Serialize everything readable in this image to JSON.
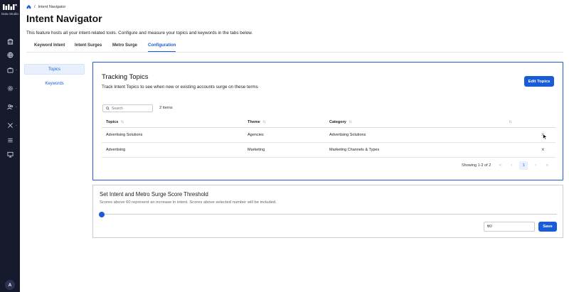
{
  "app": {
    "brand": "Data Studio",
    "user_initial": "A"
  },
  "rail": {
    "items": [
      {
        "icon": "building-icon"
      },
      {
        "icon": "globe-icon"
      },
      {
        "icon": "briefcase-icon"
      },
      {
        "icon": "gear-icon"
      },
      {
        "icon": "users-icon"
      },
      {
        "icon": "tools-icon"
      },
      {
        "icon": "list-icon"
      },
      {
        "icon": "monitor-icon"
      }
    ]
  },
  "breadcrumb": {
    "separator": "/",
    "current": "Intent Navigator"
  },
  "page": {
    "title": "Intent Navigator",
    "description": "This feature hosts all your intent-related tools. Configure and measure your topics and keywords in the tabs below."
  },
  "tabs": [
    {
      "label": "Keyword Intent",
      "active": false
    },
    {
      "label": "Intent Surges",
      "active": false
    },
    {
      "label": "Metro Surge",
      "active": false
    },
    {
      "label": "Configuration",
      "active": true
    }
  ],
  "subnav": [
    {
      "label": "Topics",
      "active": true
    },
    {
      "label": "Keywords",
      "active": false
    }
  ],
  "tracking": {
    "title": "Tracking Topics",
    "subtitle": "Track Intent Topics to see when new or existing accounts surge on these terms",
    "edit_label": "Edit Topics",
    "search_placeholder": "Search",
    "item_count": "2 items",
    "columns": [
      "Topics",
      "Theme",
      "Category"
    ],
    "rows": [
      {
        "topic": "Advertising Solutions",
        "theme": "Agencies",
        "category": "Advertising Solutions"
      },
      {
        "topic": "Advertising",
        "theme": "Marketing",
        "category": "Marketing Channels & Types"
      }
    ],
    "pagination": {
      "info": "Showing 1-2 of 2",
      "current_page": "1"
    }
  },
  "threshold": {
    "title": "Set Intent and Metro Surge Score Threshold",
    "subtitle": "Scores above 60 represent an increase in intent. Scores above selected number will be included.",
    "value": "60",
    "slider_level": 0,
    "save_label": "Save"
  },
  "colors": {
    "accent": "#1a5bd8",
    "rail": "#161a2c"
  }
}
